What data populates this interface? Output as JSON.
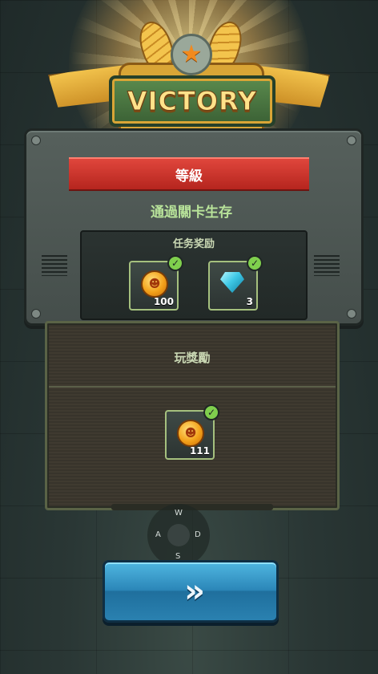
{
  "result": {
    "title": "VICTORY"
  },
  "level_panel": {
    "ribbon_label": "等級",
    "subtitle": "通過關卡生存",
    "rewards_title": "任务奖励",
    "rewards": [
      {
        "icon": "coin-icon",
        "count": "100",
        "claimed": true
      },
      {
        "icon": "diamond-icon",
        "count": "3",
        "claimed": true
      }
    ]
  },
  "play_rewards": {
    "label": "玩獎勵",
    "items": [
      {
        "icon": "coin-icon",
        "count": "111",
        "claimed": true
      }
    ]
  },
  "joystick": {
    "up": "W",
    "left": "A",
    "right": "D",
    "down": "S"
  },
  "next_button": {
    "label": "»"
  },
  "colors": {
    "accent_green": "#b8e39a",
    "ribbon_red": "#c9302a",
    "button_blue": "#2b86b8",
    "gold": "#f3c44d"
  }
}
